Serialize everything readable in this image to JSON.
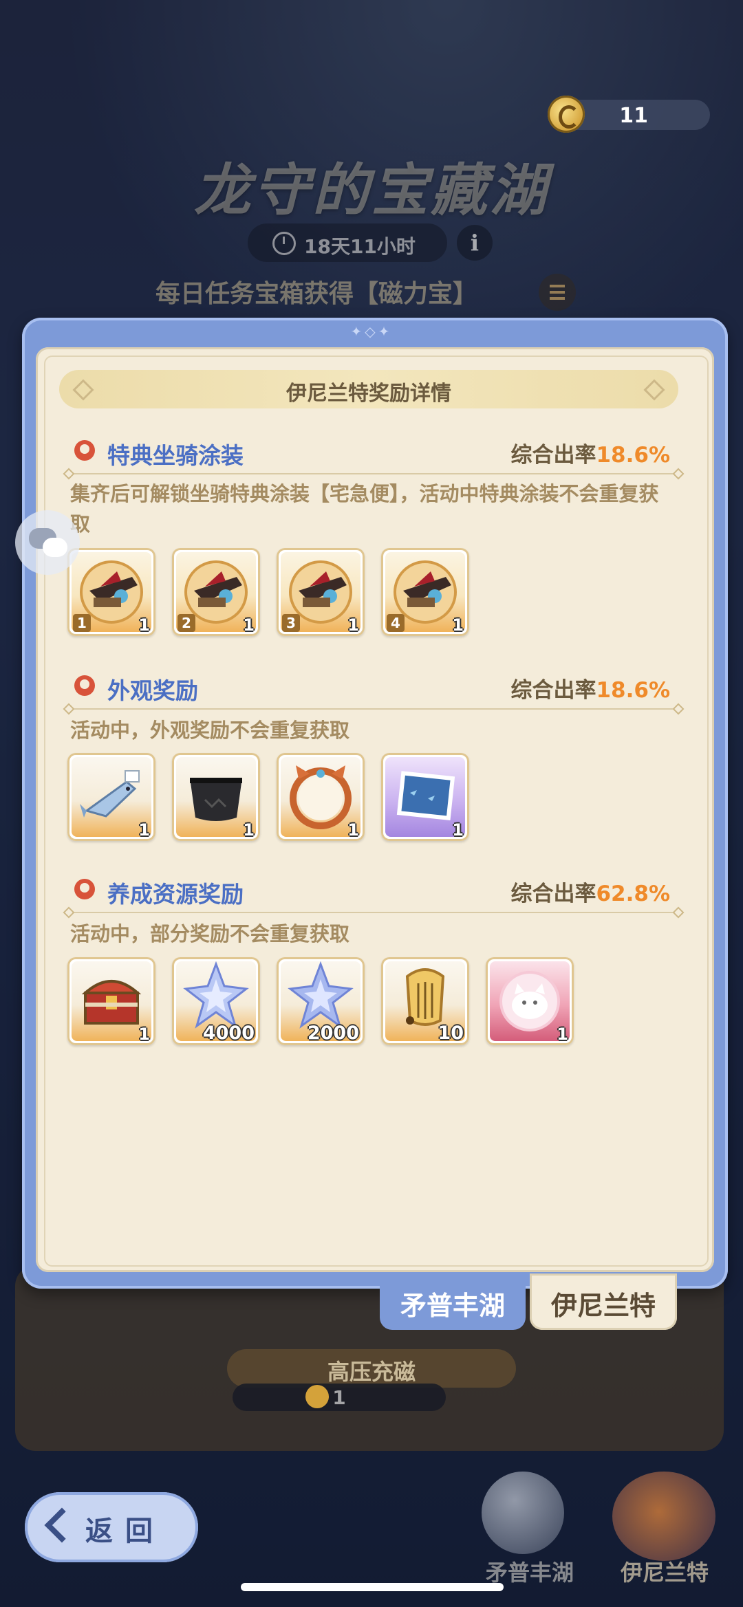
{
  "header": {
    "currency_value": "11",
    "event_title": "龙守的宝藏湖",
    "timer": "18天11小时",
    "daily_task_text": "每日任务宝箱获得【磁力宝】"
  },
  "modal": {
    "title": "伊尼兰特奖励详情",
    "sections": [
      {
        "title": "特典坐骑涂装",
        "rate_label": "综合出率",
        "rate_value": "18.6%",
        "description": "集齐后可解锁坐骑特典涂装【宅急便】，活动中特典涂装不会重复获取",
        "items": [
          {
            "icon": "mount-paint-1-icon",
            "index": "1",
            "count": "1"
          },
          {
            "icon": "mount-paint-2-icon",
            "index": "2",
            "count": "1"
          },
          {
            "icon": "mount-paint-3-icon",
            "index": "3",
            "count": "1"
          },
          {
            "icon": "mount-paint-4-icon",
            "index": "4",
            "count": "1"
          }
        ]
      },
      {
        "title": "外观奖励",
        "rate_label": "综合出率",
        "rate_value": "18.6%",
        "description": "活动中，外观奖励不会重复获取",
        "items": [
          {
            "icon": "fish-icon",
            "count": "1"
          },
          {
            "icon": "black-cape-icon",
            "count": "1"
          },
          {
            "icon": "avatar-frame-icon",
            "count": "1"
          },
          {
            "icon": "ocean-picture-icon",
            "count": "1"
          }
        ]
      },
      {
        "title": "养成资源奖励",
        "rate_label": "综合出率",
        "rate_value": "62.8%",
        "description": "活动中，部分奖励不会重复获取",
        "items": [
          {
            "icon": "treasure-chest-icon",
            "count": "1"
          },
          {
            "icon": "star-crystal-icon",
            "count": "4000"
          },
          {
            "icon": "star-crystal-icon",
            "count": "2000"
          },
          {
            "icon": "lyre-icon",
            "count": "10"
          },
          {
            "icon": "cat-sticker-icon",
            "count": "1"
          }
        ]
      }
    ],
    "tabs": [
      "矛普丰湖",
      "伊尼兰特"
    ]
  },
  "bottom": {
    "charge_label": "高压充磁",
    "charge_value": "1",
    "back_label": "返回",
    "pool_labels": [
      "矛普丰湖",
      "伊尼兰特"
    ]
  },
  "colors": {
    "accent_blue": "#4b6fc4",
    "rate_orange": "#ef8a2a",
    "panel": "#f4ecda",
    "frame": "#7d9ad8"
  }
}
